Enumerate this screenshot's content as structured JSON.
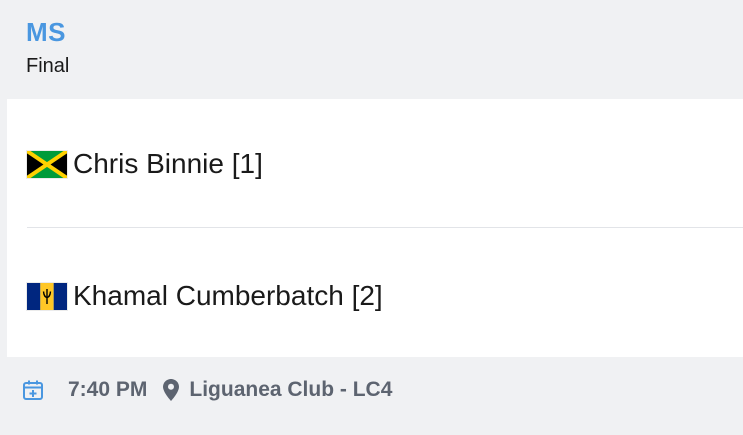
{
  "match": {
    "event_code": "MS",
    "round": "Final"
  },
  "players": [
    {
      "name": "Chris Binnie [1]",
      "flag_icon": "jamaica-flag-icon"
    },
    {
      "name": "Khamal Cumberbatch [2]",
      "flag_icon": "barbados-flag-icon"
    }
  ],
  "footer": {
    "time": "7:40 PM",
    "location": "Liguanea Club - LC4",
    "calendar_icon": "calendar-icon",
    "location_icon": "map-pin-icon"
  },
  "colors": {
    "accent": "#4a97e0",
    "card_background": "#f0f1f3",
    "footer_text": "#5d6470"
  }
}
